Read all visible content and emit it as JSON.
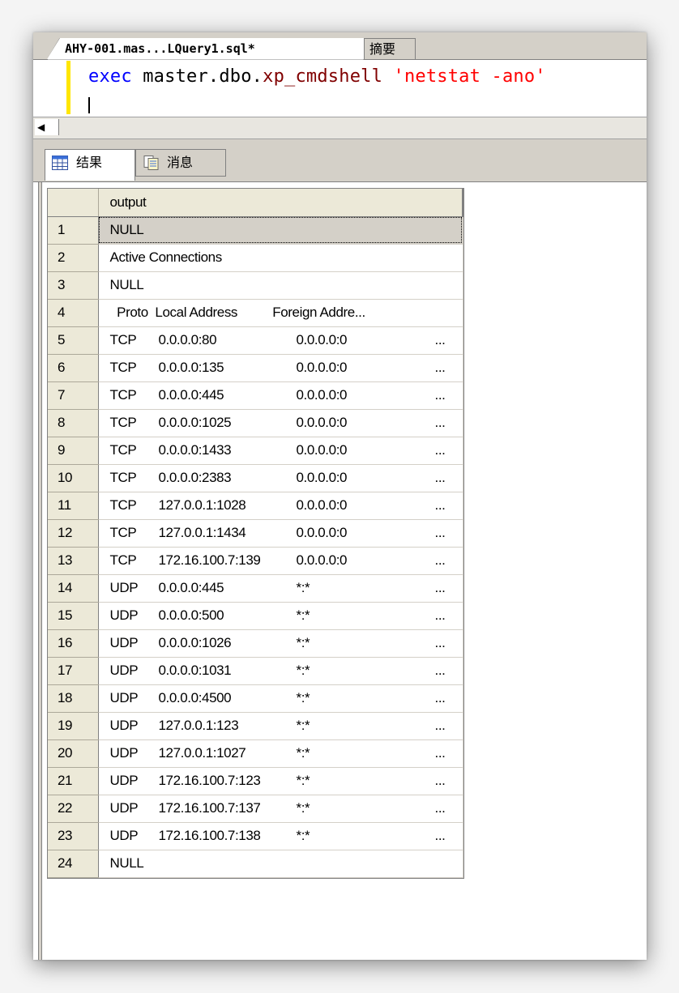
{
  "editor": {
    "active_tab": "AHY-001.mas...LQuery1.sql*",
    "inactive_tab": "摘要",
    "code": {
      "keyword": "exec",
      "object": "master.dbo.",
      "procedure": "xp_cmdshell",
      "argument": "'netstat -ano'"
    },
    "scroll_left": "◀"
  },
  "results_tabs": {
    "results_label": "结果",
    "messages_label": "消息"
  },
  "grid": {
    "column_header": "output",
    "rows": [
      {
        "n": "1",
        "text": "NULL"
      },
      {
        "n": "2",
        "text": "Active Connections"
      },
      {
        "n": "3",
        "text": "NULL"
      },
      {
        "n": "4",
        "text": "  Proto  Local Address          Foreign Addre..."
      },
      {
        "n": "5",
        "proto": "TCP",
        "local": "0.0.0.0:80",
        "foreign": "0.0.0.0:0",
        "more": "..."
      },
      {
        "n": "6",
        "proto": "TCP",
        "local": "0.0.0.0:135",
        "foreign": "0.0.0.0:0",
        "more": "..."
      },
      {
        "n": "7",
        "proto": "TCP",
        "local": "0.0.0.0:445",
        "foreign": "0.0.0.0:0",
        "more": "..."
      },
      {
        "n": "8",
        "proto": "TCP",
        "local": "0.0.0.0:1025",
        "foreign": "0.0.0.0:0",
        "more": "..."
      },
      {
        "n": "9",
        "proto": "TCP",
        "local": "0.0.0.0:1433",
        "foreign": "0.0.0.0:0",
        "more": "..."
      },
      {
        "n": "10",
        "proto": "TCP",
        "local": "0.0.0.0:2383",
        "foreign": "0.0.0.0:0",
        "more": "..."
      },
      {
        "n": "11",
        "proto": "TCP",
        "local": "127.0.0.1:1028",
        "foreign": "0.0.0.0:0",
        "more": "..."
      },
      {
        "n": "12",
        "proto": "TCP",
        "local": "127.0.0.1:1434",
        "foreign": "0.0.0.0:0",
        "more": "..."
      },
      {
        "n": "13",
        "proto": "TCP",
        "local": "172.16.100.7:139",
        "foreign": "0.0.0.0:0",
        "more": "..."
      },
      {
        "n": "14",
        "proto": "UDP",
        "local": "0.0.0.0:445",
        "foreign": "*:*",
        "more": "..."
      },
      {
        "n": "15",
        "proto": "UDP",
        "local": "0.0.0.0:500",
        "foreign": "*:*",
        "more": "..."
      },
      {
        "n": "16",
        "proto": "UDP",
        "local": "0.0.0.0:1026",
        "foreign": "*:*",
        "more": "..."
      },
      {
        "n": "17",
        "proto": "UDP",
        "local": "0.0.0.0:1031",
        "foreign": "*:*",
        "more": "..."
      },
      {
        "n": "18",
        "proto": "UDP",
        "local": "0.0.0.0:4500",
        "foreign": "*:*",
        "more": "..."
      },
      {
        "n": "19",
        "proto": "UDP",
        "local": "127.0.0.1:123",
        "foreign": "*:*",
        "more": "..."
      },
      {
        "n": "20",
        "proto": "UDP",
        "local": "127.0.0.1:1027",
        "foreign": "*:*",
        "more": "..."
      },
      {
        "n": "21",
        "proto": "UDP",
        "local": "172.16.100.7:123",
        "foreign": "*:*",
        "more": "..."
      },
      {
        "n": "22",
        "proto": "UDP",
        "local": "172.16.100.7:137",
        "foreign": "*:*",
        "more": "..."
      },
      {
        "n": "23",
        "proto": "UDP",
        "local": "172.16.100.7:138",
        "foreign": "*:*",
        "more": "..."
      },
      {
        "n": "24",
        "text": "NULL"
      }
    ]
  },
  "colors": {
    "keyword": "#0000ff",
    "procedure": "#800000",
    "string": "#ff0000",
    "chrome": "#d4d0c8",
    "header": "#ece9d8",
    "modified_marker": "#ffe600"
  }
}
